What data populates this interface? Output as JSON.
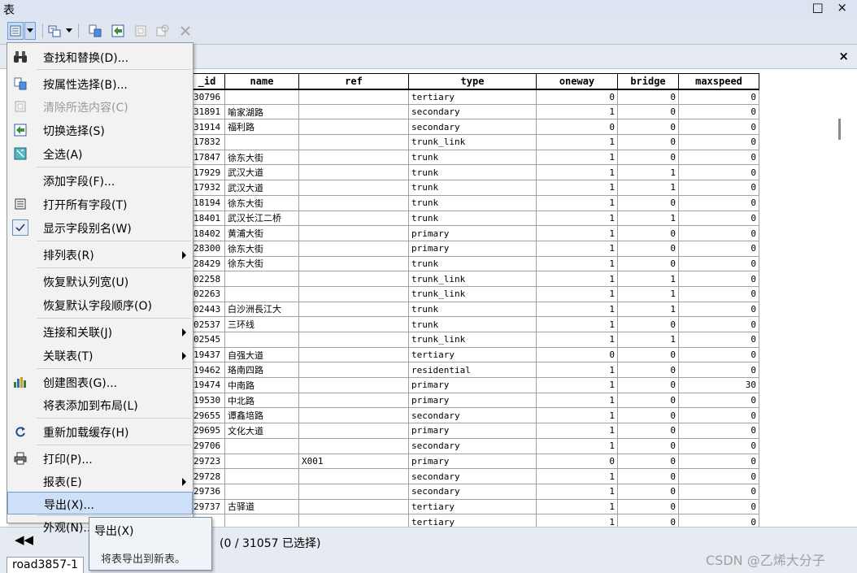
{
  "window": {
    "title": "表",
    "buttons": "□ ×"
  },
  "pane": {
    "close_glyph": "×"
  },
  "table": {
    "columns": [
      "_id",
      "name",
      "ref",
      "type",
      "oneway",
      "bridge",
      "maxspeed"
    ],
    "rows": [
      [
        "30796",
        "",
        "",
        "tertiary",
        "0",
        "0",
        "0"
      ],
      [
        "31891",
        "喻家湖路",
        "",
        "secondary",
        "1",
        "0",
        "0"
      ],
      [
        "31914",
        "福利路",
        "",
        "secondary",
        "0",
        "0",
        "0"
      ],
      [
        "17832",
        "",
        "",
        "trunk_link",
        "1",
        "0",
        "0"
      ],
      [
        "17847",
        "徐东大街",
        "",
        "trunk",
        "1",
        "0",
        "0"
      ],
      [
        "17929",
        "武汉大道",
        "",
        "trunk",
        "1",
        "1",
        "0"
      ],
      [
        "17932",
        "武汉大道",
        "",
        "trunk",
        "1",
        "1",
        "0"
      ],
      [
        "18194",
        "徐东大街",
        "",
        "trunk",
        "1",
        "0",
        "0"
      ],
      [
        "18401",
        "武汉长江二桥",
        "",
        "trunk",
        "1",
        "1",
        "0"
      ],
      [
        "18402",
        "黄浦大街",
        "",
        "primary",
        "1",
        "0",
        "0"
      ],
      [
        "28300",
        "徐东大街",
        "",
        "primary",
        "1",
        "0",
        "0"
      ],
      [
        "28429",
        "徐东大街",
        "",
        "trunk",
        "1",
        "0",
        "0"
      ],
      [
        "02258",
        "",
        "",
        "trunk_link",
        "1",
        "1",
        "0"
      ],
      [
        "02263",
        "",
        "",
        "trunk_link",
        "1",
        "1",
        "0"
      ],
      [
        "02443",
        "白沙洲長江大",
        "",
        "trunk",
        "1",
        "1",
        "0"
      ],
      [
        "02537",
        "三环线",
        "",
        "trunk",
        "1",
        "0",
        "0"
      ],
      [
        "02545",
        "",
        "",
        "trunk_link",
        "1",
        "1",
        "0"
      ],
      [
        "19437",
        "自强大道",
        "",
        "tertiary",
        "0",
        "0",
        "0"
      ],
      [
        "19462",
        "珞南四路",
        "",
        "residential",
        "1",
        "0",
        "0"
      ],
      [
        "19474",
        "中南路",
        "",
        "primary",
        "1",
        "0",
        "30"
      ],
      [
        "19530",
        "中北路",
        "",
        "primary",
        "1",
        "0",
        "0"
      ],
      [
        "29655",
        "谭鑫培路",
        "",
        "secondary",
        "1",
        "0",
        "0"
      ],
      [
        "29695",
        "文化大道",
        "",
        "primary",
        "1",
        "0",
        "0"
      ],
      [
        "29706",
        "",
        "",
        "secondary",
        "1",
        "0",
        "0"
      ],
      [
        "29723",
        "",
        "X001",
        "primary",
        "0",
        "0",
        "0"
      ],
      [
        "29728",
        "",
        "",
        "secondary",
        "1",
        "0",
        "0"
      ],
      [
        "29736",
        "",
        "",
        "secondary",
        "1",
        "0",
        "0"
      ],
      [
        "29737",
        "古驿道",
        "",
        "tertiary",
        "1",
        "0",
        "0"
      ],
      [
        "39",
        "",
        "",
        "tertiary",
        "1",
        "0",
        "0"
      ]
    ]
  },
  "status": {
    "count": "(0 / 31057 已选择)",
    "nav": "◀◀"
  },
  "bottom_tab": "road3857-1",
  "watermark": "CSDN @乙烯大分子",
  "menu": {
    "items": [
      {
        "label": "查找和替换(D)...",
        "icon": "binoculars-icon"
      },
      {
        "label": "按属性选择(B)...",
        "icon": "select-by-attributes-icon"
      },
      {
        "label": "清除所选内容(C)",
        "icon": "clear-selection-icon",
        "disabled": true
      },
      {
        "label": "切换选择(S)",
        "icon": "switch-selection-icon"
      },
      {
        "label": "全选(A)",
        "icon": "select-all-icon"
      },
      {
        "label": "添加字段(F)..."
      },
      {
        "label": "打开所有字段(T)",
        "icon": "fields-list-icon"
      },
      {
        "label": "显示字段别名(W)",
        "icon": "checkmark-icon"
      },
      {
        "label": "排列表(R)"
      },
      {
        "label": "恢复默认列宽(U)"
      },
      {
        "label": "恢复默认字段顺序(O)"
      },
      {
        "label": "连接和关联(J)"
      },
      {
        "label": "关联表(T)"
      },
      {
        "label": "创建图表(G)...",
        "icon": "bar-chart-icon"
      },
      {
        "label": "将表添加到布局(L)"
      },
      {
        "label": "重新加载缓存(H)",
        "icon": "reload-icon"
      },
      {
        "label": "打印(P)...",
        "icon": "printer-icon"
      },
      {
        "label": "报表(E)"
      },
      {
        "label": "导出(X)..."
      },
      {
        "label": "外观(N)..."
      }
    ]
  },
  "tooltip": {
    "title": "导出(X)",
    "description": "将表导出到新表。"
  },
  "colors": {
    "menu_highlight": "#cde0f7",
    "menu_highlight_border": "#6fa0db",
    "window_bg": "#dfe6f0"
  }
}
